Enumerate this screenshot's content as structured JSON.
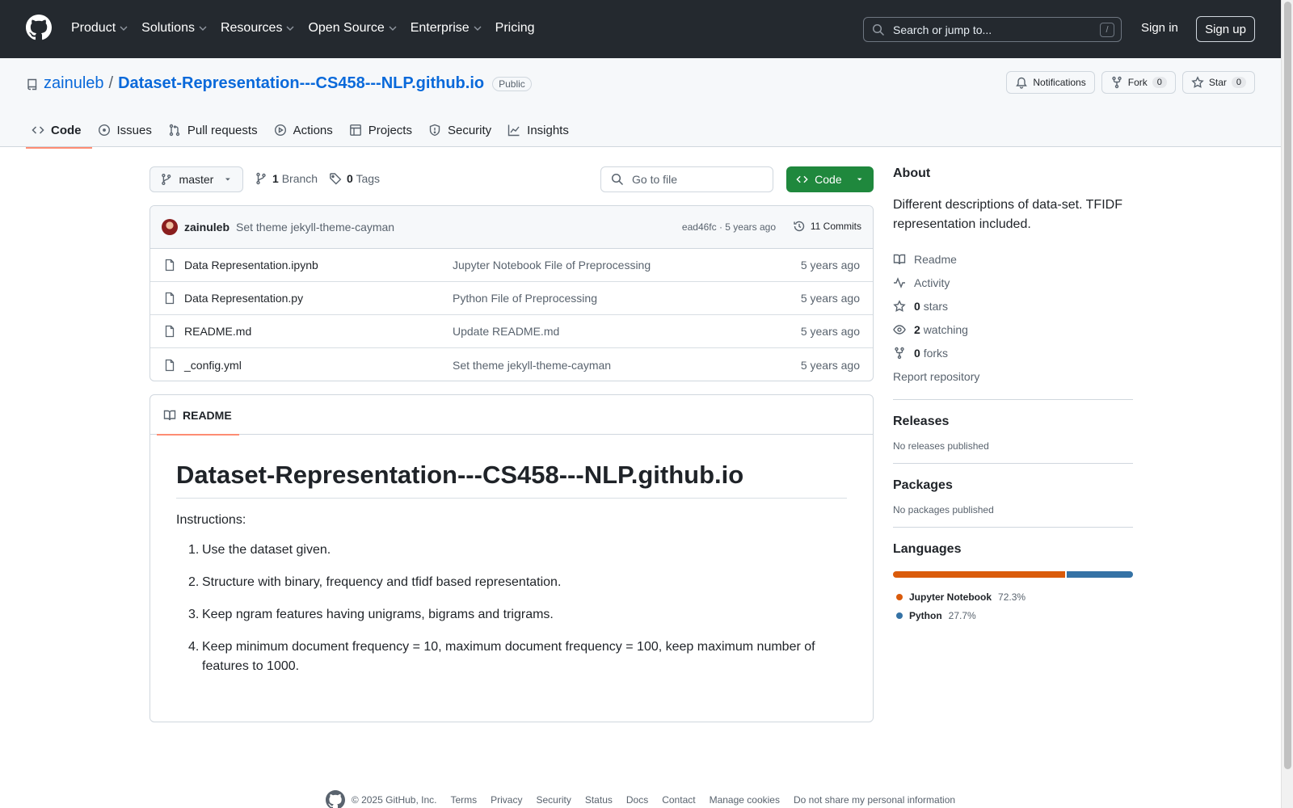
{
  "header": {
    "nav": [
      {
        "label": "Product"
      },
      {
        "label": "Solutions"
      },
      {
        "label": "Resources"
      },
      {
        "label": "Open Source"
      },
      {
        "label": "Enterprise"
      },
      {
        "label": "Pricing"
      }
    ],
    "search_placeholder": "Search or jump to...",
    "search_key": "/",
    "signin": "Sign in",
    "signup": "Sign up",
    "logo_icon": "github-mark-icon"
  },
  "repo": {
    "owner": "zainuleb",
    "separator": "/",
    "name": "Dataset-Representation---CS458---NLP.github.io",
    "visibility": "Public",
    "notifications": "Notifications",
    "fork_label": "Fork",
    "fork_count": "0",
    "star_label": "Star",
    "star_count": "0"
  },
  "tabs": [
    {
      "label": "Code",
      "icon": "code-icon"
    },
    {
      "label": "Issues",
      "icon": "issue-icon"
    },
    {
      "label": "Pull requests",
      "icon": "pull-request-icon"
    },
    {
      "label": "Actions",
      "icon": "play-icon"
    },
    {
      "label": "Projects",
      "icon": "table-icon"
    },
    {
      "label": "Security",
      "icon": "shield-icon"
    },
    {
      "label": "Insights",
      "icon": "graph-icon"
    }
  ],
  "toolbar": {
    "branch": "master",
    "branch_count": "1",
    "branch_label": "Branch",
    "tag_count": "0",
    "tag_label": "Tags",
    "goto_placeholder": "Go to file",
    "code_button": "Code"
  },
  "commit": {
    "author": "zainuleb",
    "message": "Set theme jekyll-theme-cayman",
    "meta": "ead46fc · 5 years ago",
    "commits": "11 Commits"
  },
  "files": [
    {
      "name": "Data Representation.ipynb",
      "commit": "Jupyter Notebook File of Preprocessing",
      "time": "5 years ago"
    },
    {
      "name": "Data Representation.py",
      "commit": "Python File of Preprocessing",
      "time": "5 years ago"
    },
    {
      "name": "README.md",
      "commit": "Update README.md",
      "time": "5 years ago"
    },
    {
      "name": "_config.yml",
      "commit": "Set theme jekyll-theme-cayman",
      "time": "5 years ago"
    }
  ],
  "readme": {
    "tab": "README",
    "title": "Dataset-Representation---CS458---NLP.github.io",
    "intro": "Instructions:",
    "items": [
      {
        "num": "1.",
        "text": "Use the dataset given."
      },
      {
        "num": "2.",
        "text": "Structure with binary, frequency and tfidf based representation."
      },
      {
        "num": "3.",
        "text": "Keep ngram features having unigrams, bigrams and trigrams."
      },
      {
        "num": "4.",
        "text": "Keep minimum document frequency = 10, maximum document frequency = 100, keep maximum number of features to 1000."
      }
    ]
  },
  "about": {
    "heading": "About",
    "description": "Different descriptions of data-set. TFIDF representation included.",
    "readme": "Readme",
    "activity": "Activity",
    "stars_count": "0",
    "stars_label": "stars",
    "watching_count": "2",
    "watching_label": "watching",
    "forks_count": "0",
    "forks_label": "forks",
    "report": "Report repository"
  },
  "releases": {
    "heading": "Releases",
    "text": "No releases published"
  },
  "packages": {
    "heading": "Packages",
    "text": "No packages published"
  },
  "languages": {
    "heading": "Languages",
    "items": [
      {
        "name": "Jupyter Notebook",
        "percent": "72.3%",
        "value": 72.3,
        "color": "#DA5B0B"
      },
      {
        "name": "Python",
        "percent": "27.7%",
        "value": 27.7,
        "color": "#3572A5"
      }
    ]
  },
  "footer": {
    "copyright": "© 2025 GitHub, Inc.",
    "links": [
      "Terms",
      "Privacy",
      "Security",
      "Status",
      "Docs",
      "Contact",
      "Manage cookies",
      "Do not share my personal information"
    ]
  }
}
